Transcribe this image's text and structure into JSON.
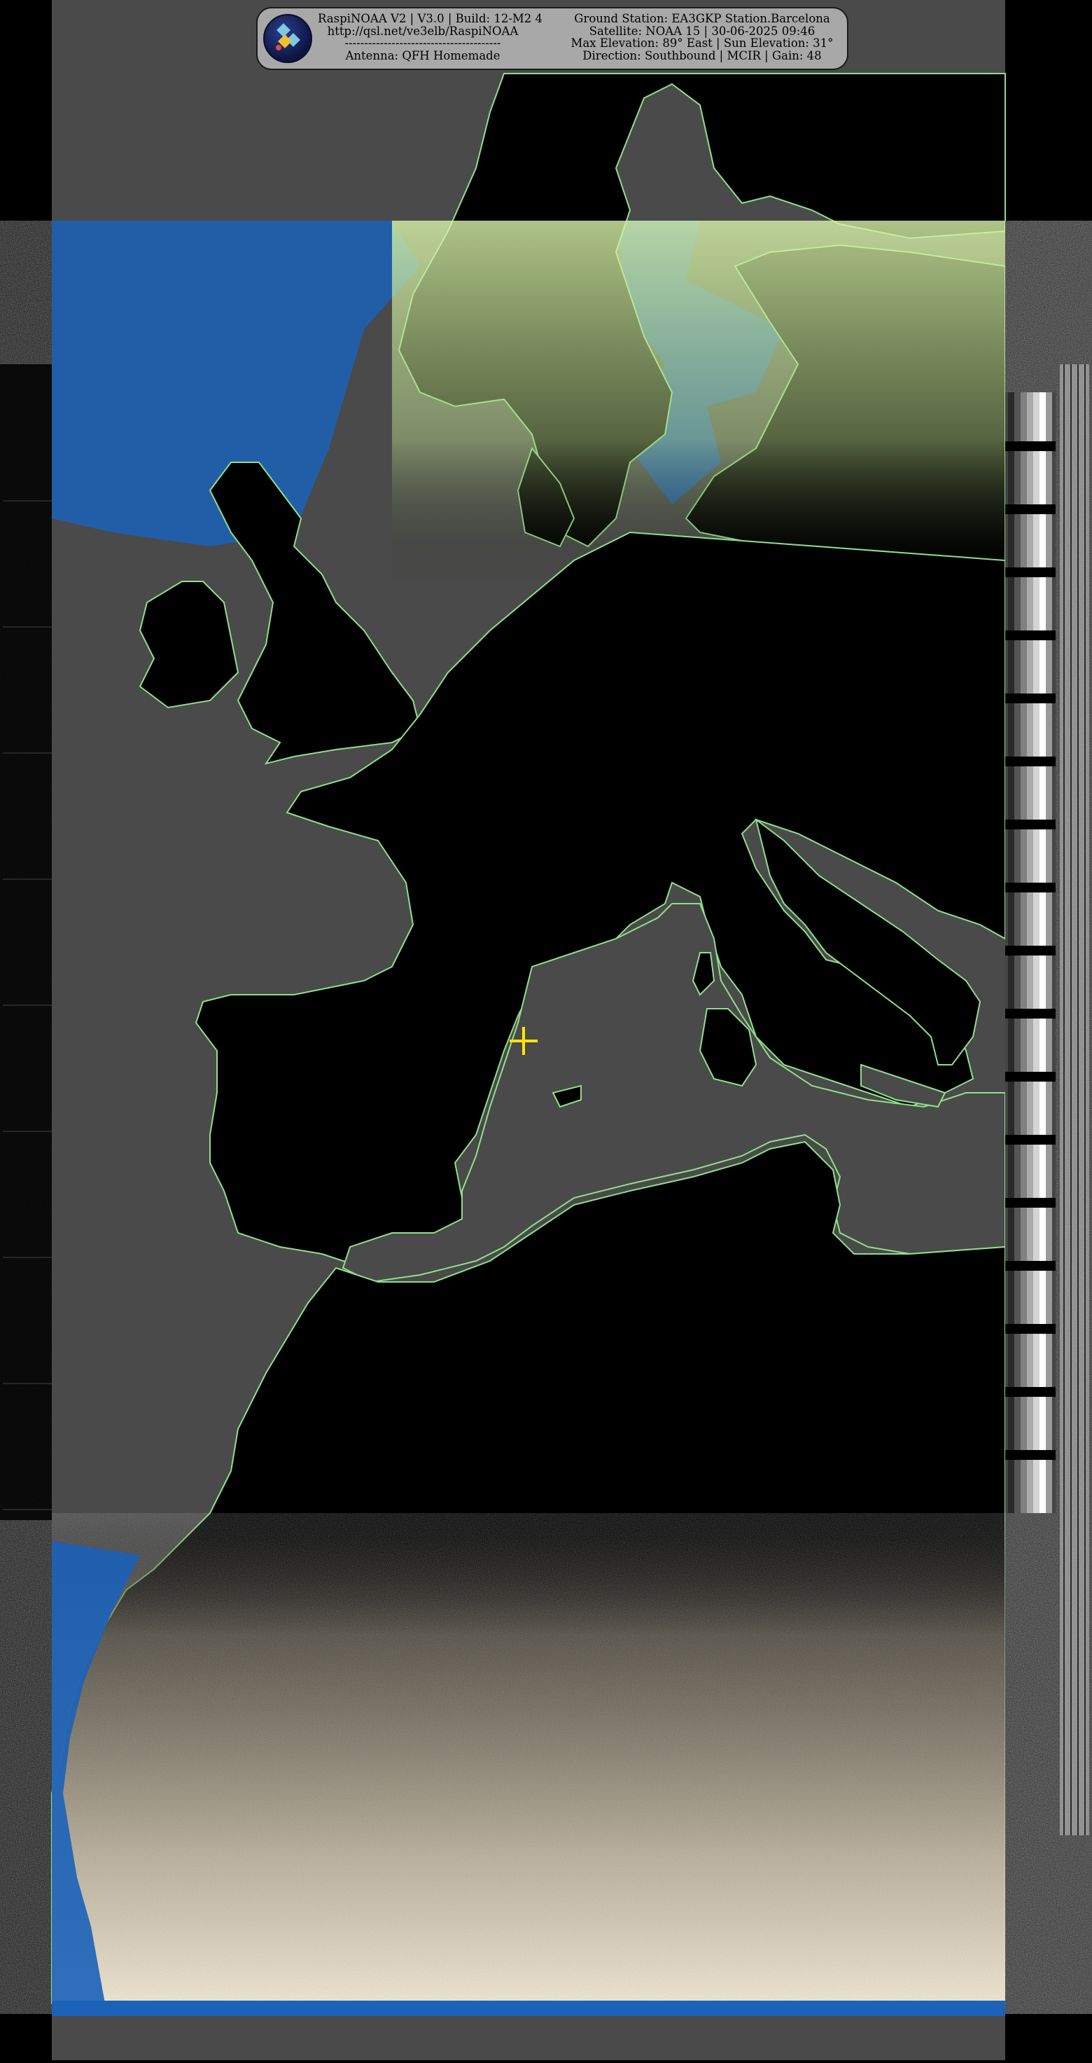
{
  "header": {
    "left_lines": [
      "RaspiNOAA V2 | V3.0 | Build: 12-M2 4",
      "http://qsl.net/ve3elb/RaspiNOAA",
      "----------------------------------------",
      "Antenna: QFH Homemade"
    ],
    "right_lines": [
      "Ground Station: EA3GKP Station.Barcelona",
      "Satellite: NOAA 15 | 30-06-2025 09:46",
      "Max Elevation: 89° East | Sun Elevation: 31°",
      "Direction: Southbound | MCIR | Gain: 48"
    ],
    "logo_icon": "satellite-logo-icon"
  },
  "map": {
    "marker_icon": "station-crosshair-icon",
    "colors": {
      "sea": "#4a4a4a",
      "land": "#000000",
      "coast": "#8fe08a",
      "water_overlay": "#1b62b8",
      "cloud_green": "#d8f2a8",
      "cloud_cream": "#f3ead2",
      "marker": "#ffe600"
    }
  }
}
